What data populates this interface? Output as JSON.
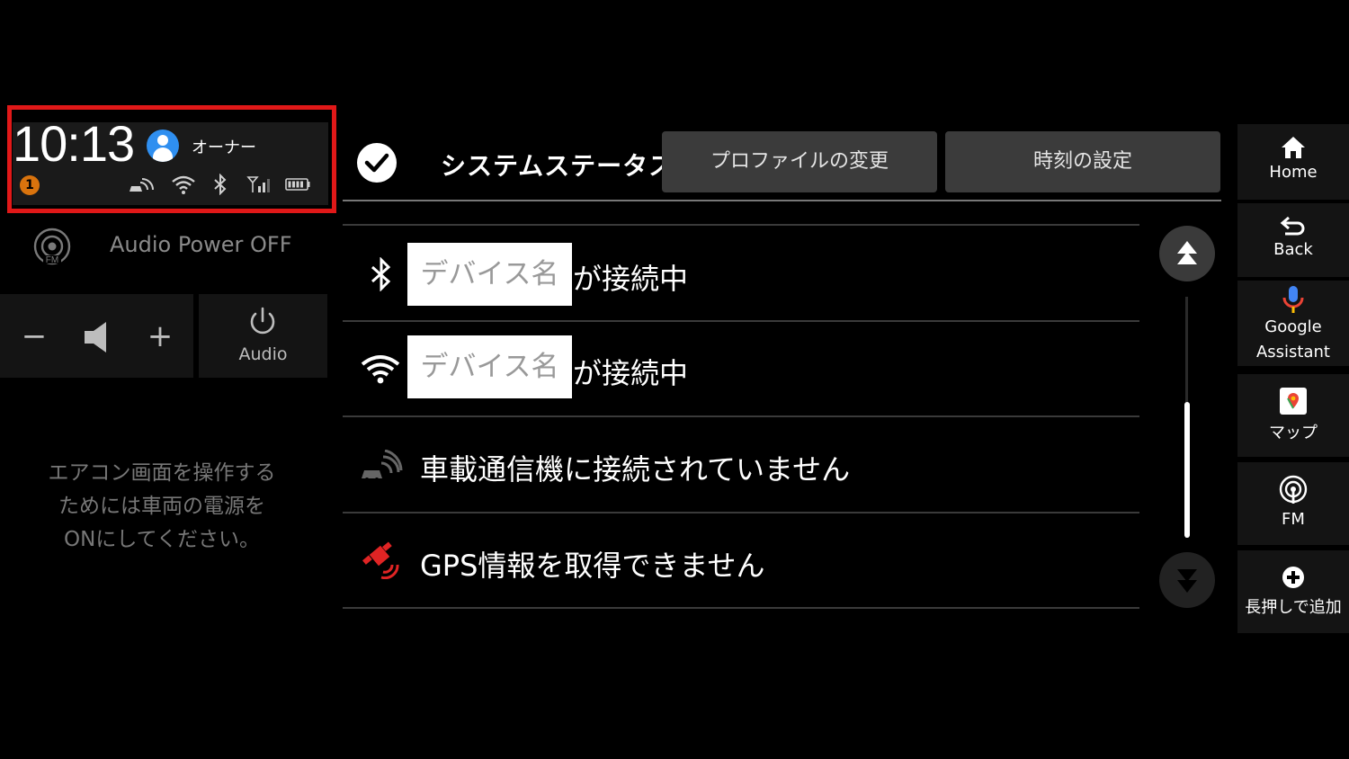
{
  "status_bar": {
    "time": "10:13",
    "user_name": "オーナー",
    "notification_count": "1",
    "icons": [
      "car-connect-icon",
      "wifi-icon",
      "bluetooth-icon",
      "signal-icon",
      "battery-icon"
    ],
    "highlight_color": "#e01818"
  },
  "audio": {
    "source_icon": "FM",
    "status": "Audio Power OFF",
    "minus": "−",
    "plus": "+",
    "button_label": "Audio"
  },
  "aircon_message": {
    "line1": "エアコン画面を操作する",
    "line2": "ためには車両の電源を",
    "line3": "ONにしてください。"
  },
  "header": {
    "title": "システムステータス",
    "profile_button": "プロファイルの変更",
    "time_button": "時刻の設定"
  },
  "status_list": [
    {
      "icon": "bluetooth-icon",
      "device": "デバイス名",
      "text": "が接続中"
    },
    {
      "icon": "wifi-icon",
      "device": "デバイス名",
      "text": "が接続中"
    },
    {
      "icon": "car-connect-icon",
      "text": "車載通信機に接続されていません"
    },
    {
      "icon": "gps-error-icon",
      "text": "GPS情報を取得できません"
    }
  ],
  "scroll": {
    "position": 0.45
  },
  "nav": {
    "home": "Home",
    "back": "Back",
    "assistant_line1": "Google",
    "assistant_line2": "Assistant",
    "map": "マップ",
    "fm": "FM",
    "add": "長押しで追加"
  },
  "colors": {
    "accent_badge": "#d9730d",
    "gps_error": "#e02424",
    "user_avatar": "#2f8ff0"
  }
}
